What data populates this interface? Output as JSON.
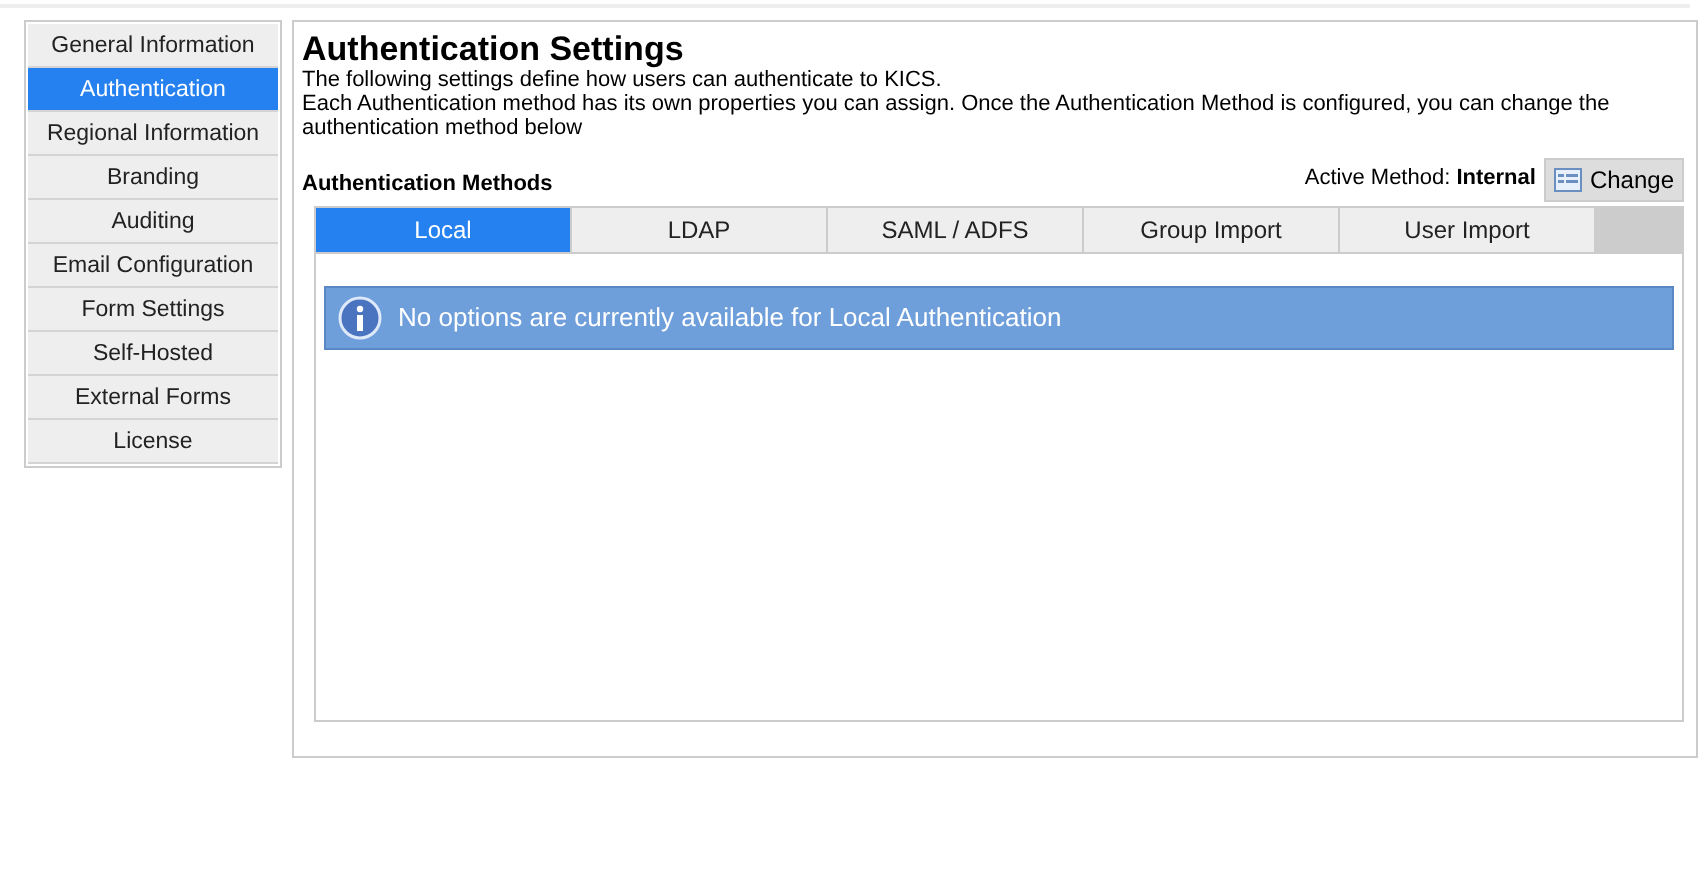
{
  "sidebar": {
    "items": [
      {
        "label": "General Information",
        "selected": false
      },
      {
        "label": "Authentication",
        "selected": true
      },
      {
        "label": "Regional Information",
        "selected": false
      },
      {
        "label": "Branding",
        "selected": false
      },
      {
        "label": "Auditing",
        "selected": false
      },
      {
        "label": "Email Configuration",
        "selected": false
      },
      {
        "label": "Form Settings",
        "selected": false
      },
      {
        "label": "Self-Hosted",
        "selected": false
      },
      {
        "label": "External Forms",
        "selected": false
      },
      {
        "label": "License",
        "selected": false
      }
    ]
  },
  "page": {
    "title": "Authentication Settings",
    "description": [
      "The following settings define how users can authenticate to KICS.",
      "Each Authentication method has its own properties you can assign. Once the Authentication Method is configured, you can change the authentication method below"
    ]
  },
  "methods": {
    "heading": "Authentication Methods",
    "active_method": "Active Method: **Internal**",
    "change_button": "Change",
    "tabs": [
      {
        "label": "Local",
        "selected": true
      },
      {
        "label": "LDAP",
        "selected": false
      },
      {
        "label": "SAML / ADFS",
        "selected": false
      },
      {
        "label": "Group Import",
        "selected": false
      },
      {
        "label": "User Import",
        "selected": false
      }
    ],
    "info_message": "No options are currently available for Local Authentication"
  }
}
